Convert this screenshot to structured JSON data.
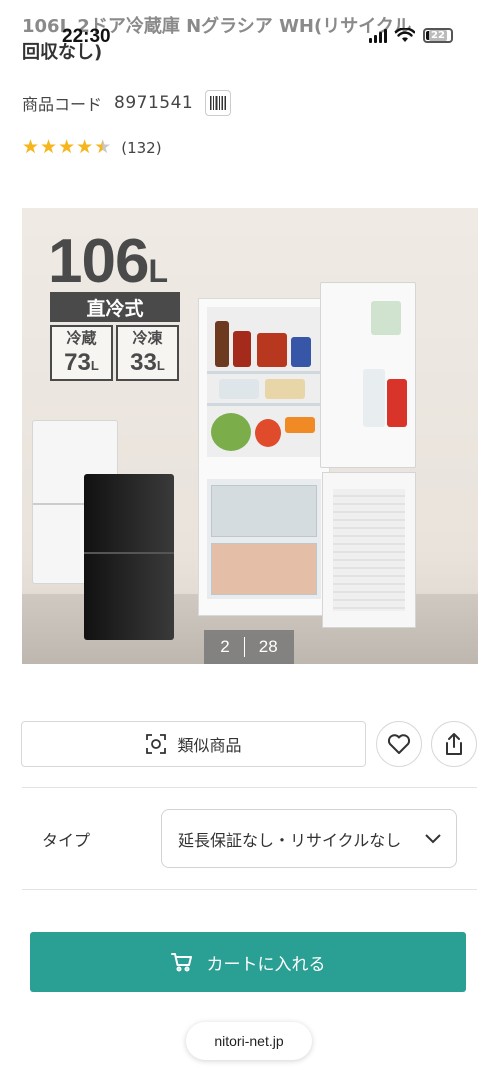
{
  "status_bar": {
    "time": "22:30",
    "battery": "22"
  },
  "product": {
    "title_line1": "106L 2ドア冷蔵庫 Nグラシア WH(リサイクル",
    "title_line2": "回収なし)",
    "code_label": "商品コード",
    "code_value": "8971541",
    "rating_stars": 4.5,
    "review_count": "(132)"
  },
  "image": {
    "capacity": "106",
    "capacity_unit": "L",
    "cooling_type": "直冷式",
    "fridge_label": "冷蔵",
    "fridge_value": "73",
    "freezer_label": "冷凍",
    "freezer_value": "33",
    "unit_small": "L",
    "current_index": "2",
    "total": "28"
  },
  "actions": {
    "similar_label": "類似商品",
    "type_label": "タイプ",
    "type_value": "延長保証なし・リサイクルなし",
    "cart_label": "カートに入れる"
  },
  "browser": {
    "url": "nitori-net.jp"
  },
  "colors": {
    "accent": "#2a9f93",
    "star": "#f5b51c"
  }
}
